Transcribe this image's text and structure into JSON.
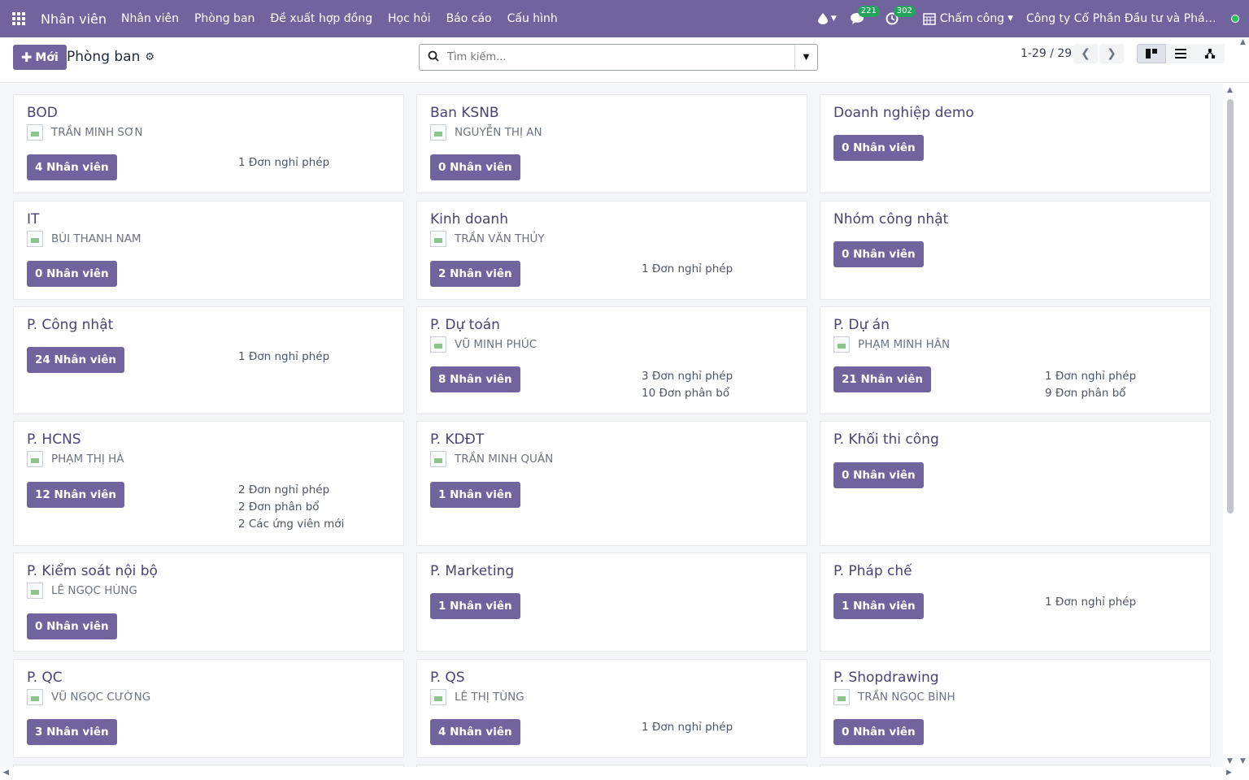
{
  "nav": {
    "app_name": "Nhân viên",
    "menu": [
      "Nhân viên",
      "Phòng ban",
      "Đề xuất hợp đồng",
      "Học hỏi",
      "Báo cáo",
      "Cấu hình"
    ],
    "messages_count": "221",
    "activities_count": "302",
    "attendance_label": "Chấm công",
    "company": "Công ty Cổ Phần Đầu tư và Phát triể...",
    "accent_color": "#71639e"
  },
  "control": {
    "new_label": "Mới",
    "breadcrumb": "Phòng ban",
    "search_placeholder": "Tìm kiếm...",
    "pager": "1-29 / 29"
  },
  "departments": [
    {
      "name": "BOD",
      "manager": "TRẦN MINH SƠN",
      "employees": "4 Nhân viên",
      "stats": [
        "1 Đơn nghỉ phép"
      ]
    },
    {
      "name": "Ban KSNB",
      "manager": "NGUYỄN THỊ AN",
      "employees": "0 Nhân viên",
      "stats": []
    },
    {
      "name": "Doanh nghiệp demo",
      "manager": "",
      "employees": "0 Nhân viên",
      "stats": []
    },
    {
      "name": "IT",
      "manager": "BÙI THANH NAM",
      "employees": "0 Nhân viên",
      "stats": []
    },
    {
      "name": "Kinh doanh",
      "manager": "TRẦN VĂN THỦY",
      "employees": "2 Nhân viên",
      "stats": [
        "1 Đơn nghỉ phép"
      ]
    },
    {
      "name": "Nhóm công nhật",
      "manager": "",
      "employees": "0 Nhân viên",
      "stats": []
    },
    {
      "name": "P. Công nhật",
      "manager": "",
      "employees": "24 Nhân viên",
      "stats": [
        "1 Đơn nghỉ phép"
      ]
    },
    {
      "name": "P. Dự toán",
      "manager": "VŨ MINH PHÚC",
      "employees": "8 Nhân viên",
      "stats": [
        "3 Đơn nghỉ phép",
        "10 Đơn phân bổ"
      ]
    },
    {
      "name": "P. Dự án",
      "manager": "PHẠM MINH HÂN",
      "employees": "21 Nhân viên",
      "stats": [
        "1 Đơn nghỉ phép",
        "9 Đơn phân bổ"
      ]
    },
    {
      "name": "P. HCNS",
      "manager": "PHẠM THỊ HÀ",
      "employees": "12 Nhân viên",
      "stats": [
        "2 Đơn nghỉ phép",
        "2 Đơn phân bổ",
        "2 Các ứng viên mới"
      ]
    },
    {
      "name": "P. KDĐT",
      "manager": "TRẦN MINH QUÂN",
      "employees": "1 Nhân viên",
      "stats": []
    },
    {
      "name": "P. Khối thi công",
      "manager": "",
      "employees": "0 Nhân viên",
      "stats": []
    },
    {
      "name": "P. Kiểm soát nội bộ",
      "manager": "LÊ NGỌC HÙNG",
      "employees": "0 Nhân viên",
      "stats": []
    },
    {
      "name": "P. Marketing",
      "manager": "",
      "employees": "1 Nhân viên",
      "stats": []
    },
    {
      "name": "P. Pháp chế",
      "manager": "",
      "employees": "1 Nhân viên",
      "stats": [
        "1 Đơn nghỉ phép"
      ]
    },
    {
      "name": "P. QC",
      "manager": "VŨ NGỌC CƯỜNG",
      "employees": "3 Nhân viên",
      "stats": []
    },
    {
      "name": "P. QS",
      "manager": "LÊ THỊ TÙNG",
      "employees": "4 Nhân viên",
      "stats": [
        "1 Đơn nghỉ phép"
      ]
    },
    {
      "name": "P. Shopdrawing",
      "manager": "TRẦN NGỌC BÌNH",
      "employees": "0 Nhân viên",
      "stats": []
    }
  ]
}
